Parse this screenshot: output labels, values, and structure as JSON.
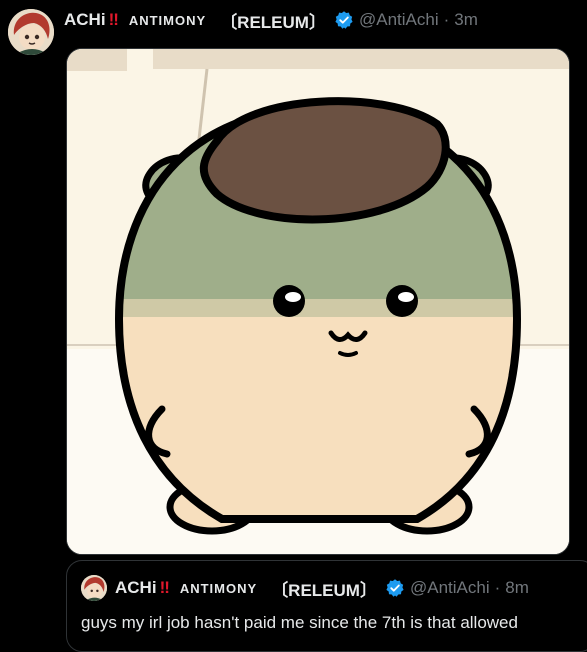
{
  "post": {
    "author": {
      "display_name": "ACHi",
      "emoji": "‼",
      "group": "ANTIMONY",
      "tag": "〔RELEUM〕",
      "handle": "@AntiAchi",
      "separator": "·",
      "time": "3m"
    }
  },
  "quote": {
    "author": {
      "display_name": "ACHi",
      "emoji": "‼",
      "group": "ANTIMONY",
      "tag": "〔RELEUM〕",
      "handle": "@AntiAchi",
      "separator": "·",
      "time": "8m"
    },
    "text": "guys my irl job hasn't paid me since the 7th is that allowed"
  },
  "colors": {
    "background": "#000000",
    "text": "#e7e9ea",
    "muted": "#71767b",
    "verified": "#1d9bf0",
    "emoji_red": "#e0182b"
  },
  "icons": {
    "verified": "verified-badge-icon",
    "avatar": "avatar-image"
  }
}
